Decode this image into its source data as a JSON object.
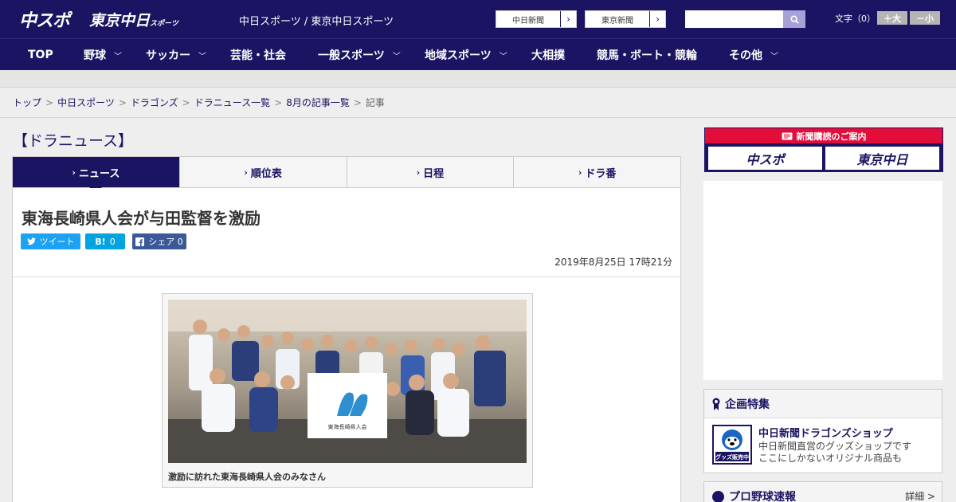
{
  "header": {
    "logo_chunichi": "中スポ",
    "logo_tokyo": "東京中日",
    "logo_tokyo_small": "スポーツ",
    "site_title": "中日スポーツ / 東京中日スポーツ",
    "newspaper_links": [
      "中日新聞",
      "東京新聞"
    ],
    "link_arrow": "›",
    "search_placeholder": "",
    "font_size_label": "文字（0）",
    "font_bigger": "＋大",
    "font_smaller": "－小"
  },
  "nav": {
    "items": [
      {
        "label": "TOP",
        "has_menu": false
      },
      {
        "label": "野球",
        "has_menu": true
      },
      {
        "label": "サッカー",
        "has_menu": true
      },
      {
        "label": "芸能・社会",
        "has_menu": false
      },
      {
        "label": "一般スポーツ",
        "has_menu": true
      },
      {
        "label": "地域スポーツ",
        "has_menu": true
      },
      {
        "label": "大相撲",
        "has_menu": false
      },
      {
        "label": "競馬・ボート・競輪",
        "has_menu": false
      },
      {
        "label": "その他",
        "has_menu": true
      }
    ],
    "chevron": "﹀"
  },
  "breadcrumb": {
    "items": [
      "トップ",
      "中日スポーツ",
      "ドラゴンズ",
      "ドラニュース一覧",
      "8月の記事一覧"
    ],
    "current": "記事",
    "separator": ">"
  },
  "section_title": "【ドラニュース】",
  "tabs": [
    {
      "label": "ニュース",
      "active": true
    },
    {
      "label": "順位表",
      "active": false
    },
    {
      "label": "日程",
      "active": false
    },
    {
      "label": "ドラ番",
      "active": false
    }
  ],
  "tab_marker": "›",
  "article": {
    "title": "東海長崎県人会が与田監督を激励",
    "tweet_label": "ツイート",
    "hatena_label": "B!",
    "hatena_count": "0",
    "share_label": "シェア 0",
    "date": "2019年8月25日 17時21分",
    "photo_caption": "激励に訪れた東海長崎県人会のみなさん",
    "banner_text": "東海長崎県人会"
  },
  "sidebar": {
    "subscribe_title": "新聞購読のご案内",
    "subscribe_logos": [
      "中スポ",
      "東京中日"
    ],
    "feature_title": "企画特集",
    "feature_item_title": "中日新聞ドラゴンズショップ",
    "feature_item_desc1": "中日新聞直営のグッズショップです",
    "feature_item_desc2": "ここにしかないオリジナル商品も",
    "feature_badge": "グッズ販売中",
    "baseball_title": "プロ野球速報",
    "baseball_more": "詳細 >"
  },
  "colors": {
    "brand": "#1b1463",
    "accent_red": "#e30d3a",
    "twitter": "#1da1f2",
    "hatena": "#00a4de",
    "facebook": "#3b5998"
  }
}
